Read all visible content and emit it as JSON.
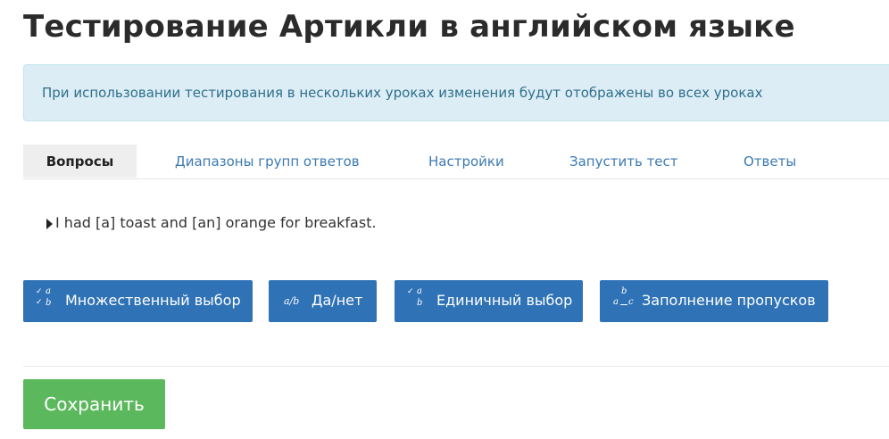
{
  "page": {
    "title": "Тестирование Артикли в английском языке"
  },
  "alert": {
    "text": "При использовании тестирования в нескольких уроках изменения будут отображены во всех уроках"
  },
  "tabs": [
    {
      "label": "Вопросы",
      "active": true
    },
    {
      "label": "Диапазоны групп ответов",
      "active": false
    },
    {
      "label": "Настройки",
      "active": false
    },
    {
      "label": "Запустить тест",
      "active": false
    },
    {
      "label": "Ответы",
      "active": false
    }
  ],
  "question": {
    "text": "I had [a] toast and [an] orange for breakfast."
  },
  "question_types": [
    {
      "label": "Множественный выбор",
      "icon": "multiple-choice-icon"
    },
    {
      "label": "Да/нет",
      "icon": "yes-no-icon"
    },
    {
      "label": "Единичный выбор",
      "icon": "single-choice-icon"
    },
    {
      "label": "Заполнение пропусков",
      "icon": "fill-blanks-icon"
    }
  ],
  "actions": {
    "save_label": "Сохранить"
  },
  "colors": {
    "primary": "#2f72b5",
    "success": "#5cb85c",
    "alert_bg": "#dcedf5",
    "link": "#3d7ab0"
  }
}
